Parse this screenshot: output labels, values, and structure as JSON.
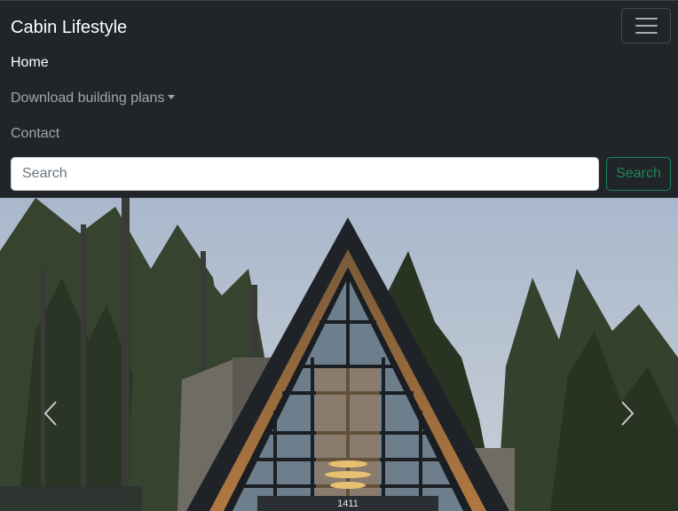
{
  "navbar": {
    "brand": "Cabin Lifestyle",
    "toggler_icon": "hamburger-icon",
    "links": [
      {
        "label": "Home",
        "active": true
      },
      {
        "label": "Download building plans",
        "dropdown": true
      },
      {
        "label": "Contact"
      }
    ]
  },
  "search": {
    "placeholder": "Search",
    "value": "",
    "button_label": "Search"
  },
  "carousel": {
    "image_description_icon": "a-frame-cabin-photo",
    "house_number": "1411",
    "prev_icon": "chevron-left-icon",
    "next_icon": "chevron-right-icon"
  },
  "colors": {
    "navbar_bg": "#212529",
    "search_button": "#198754",
    "active_link": "#ffffff",
    "inactive_link": "rgba(255,255,255,0.58)"
  }
}
